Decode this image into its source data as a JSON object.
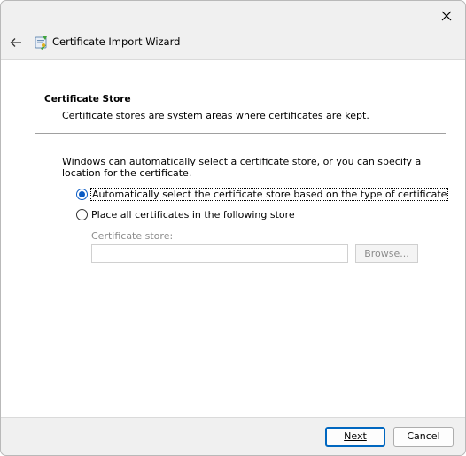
{
  "window": {
    "title": "Certificate Import Wizard",
    "close_icon": "close-icon",
    "back_icon": "back-arrow-icon",
    "wizard_icon": "certificate-wizard-icon"
  },
  "section": {
    "title": "Certificate Store",
    "description": "Certificate stores are system areas where certificates are kept."
  },
  "intro": "Windows can automatically select a certificate store, or you can specify a location for the certificate.",
  "options": {
    "auto": {
      "label": "Automatically select the certificate store based on the type of certificate",
      "selected": true
    },
    "manual": {
      "label": "Place all certificates in the following store",
      "selected": false
    }
  },
  "store": {
    "label": "Certificate store:",
    "value": "",
    "browse_label": "Browse..."
  },
  "buttons": {
    "next_label": "Next",
    "cancel_label": "Cancel"
  },
  "colors": {
    "accent": "#0067c0",
    "window_bg": "#f0f0f0",
    "disabled_text": "#8c8c8c"
  }
}
